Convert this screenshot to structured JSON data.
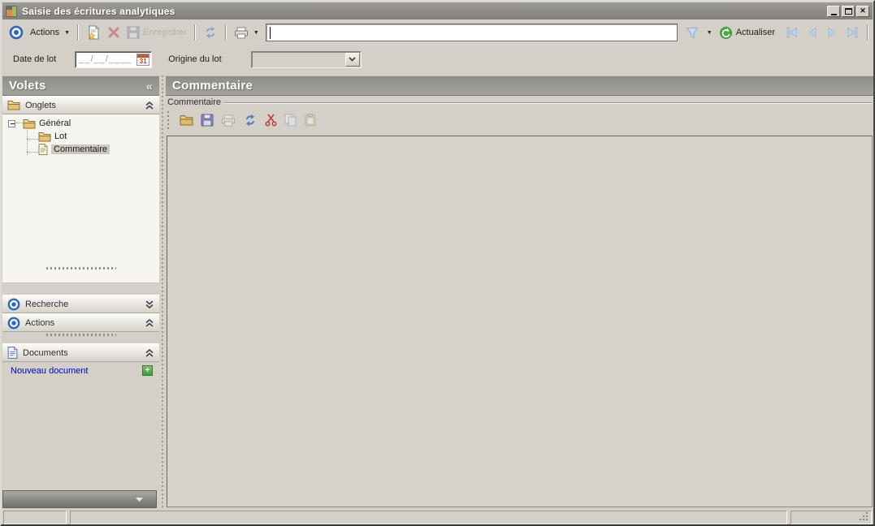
{
  "colors": {
    "window_bg": "#d4d0c8",
    "titlebar_top": "#9b9a94",
    "titlebar_bottom": "#81807a",
    "panel_header_top": "#8f8e89",
    "panel_header_bottom": "#a3a19b",
    "section_top": "#fcfbf8",
    "section_bottom": "#d6d2c9",
    "tree_bg": "#f6f5f0",
    "selection_bg": "#ccc8c0",
    "link_blue": "#0000cc",
    "content_bg": "#d6d2ca"
  },
  "window": {
    "title": "Saisie des écritures analytiques",
    "close_glyph": "✕"
  },
  "glyphs": {
    "dropdown": "▼",
    "collapse_left": "«",
    "plus": "+"
  },
  "toolbar": {
    "actions_label": "Actions",
    "enregistrer_label": "Enregistrer",
    "actualiser_label": "Actualiser",
    "search_value": ""
  },
  "lot_row": {
    "date_label": "Date de lot",
    "date_mask": "__/__/____",
    "calendar_day": "31",
    "origin_label": "Origine du lot",
    "origin_value": ""
  },
  "sidebar": {
    "title": "Volets",
    "sections": {
      "onglets": "Onglets",
      "recherche": "Recherche",
      "actions": "Actions",
      "documents": "Documents"
    },
    "tree": [
      {
        "label": "Général"
      },
      {
        "label": "Lot"
      },
      {
        "label": "Commentaire"
      }
    ],
    "new_document_label": "Nouveau document"
  },
  "main": {
    "title": "Commentaire",
    "group_label": "Commentaire",
    "content": ""
  }
}
